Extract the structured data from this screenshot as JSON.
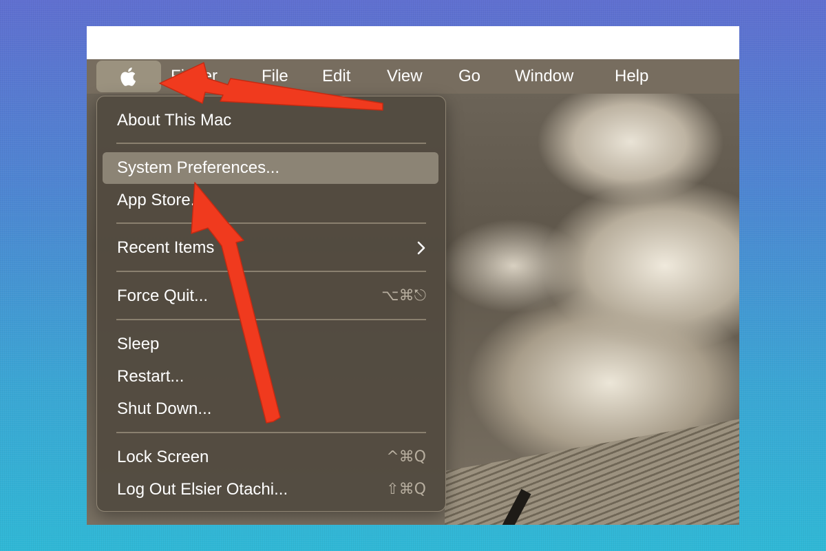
{
  "menubar": {
    "apple_icon": "apple-logo-icon",
    "items": [
      {
        "label": "Finder"
      },
      {
        "label": "File"
      },
      {
        "label": "Edit"
      },
      {
        "label": "View"
      },
      {
        "label": "Go"
      },
      {
        "label": "Window"
      },
      {
        "label": "Help"
      }
    ]
  },
  "apple_menu": {
    "items": [
      {
        "label": "About This Mac",
        "shortcut": ""
      },
      {
        "label": "System Preferences...",
        "shortcut": "",
        "selected": true
      },
      {
        "label": "App Store...",
        "shortcut": ""
      },
      {
        "label": "Recent Items",
        "shortcut": "",
        "submenu_icon": "chevron-right-icon"
      },
      {
        "label": "Force Quit...",
        "shortcut": "⌥⌘⎋"
      },
      {
        "label": "Sleep",
        "shortcut": ""
      },
      {
        "label": "Restart...",
        "shortcut": ""
      },
      {
        "label": "Shut Down...",
        "shortcut": ""
      },
      {
        "label": "Lock Screen",
        "shortcut": "^⌘Q"
      },
      {
        "label": "Log Out Elsier Otachi...",
        "shortcut": "⇧⌘Q"
      }
    ]
  },
  "annotations": {
    "arrow_color": "#f03a1e",
    "arrow_icon": "red-arrow-icon"
  },
  "colors": {
    "menubar_bg": "#776d5f",
    "menu_bg": "#524a3f",
    "menu_highlight": "#8c8475",
    "page_bg_top": "#5f6fd0",
    "page_bg_bottom": "#2fb8d6"
  }
}
